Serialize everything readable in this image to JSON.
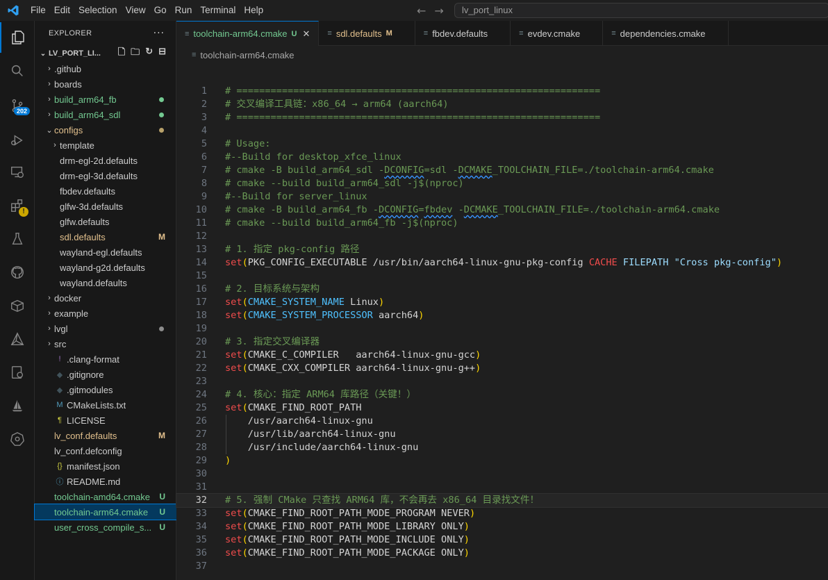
{
  "titlebar": {
    "menu": [
      "File",
      "Edit",
      "Selection",
      "View",
      "Go",
      "Run",
      "Terminal",
      "Help"
    ],
    "search": "lv_port_linux"
  },
  "activity": {
    "scm_badge": "202",
    "warning_badge": "!"
  },
  "explorer": {
    "title": "EXPLORER",
    "more": "···",
    "root": "LV_PORT_LI...",
    "tree": [
      {
        "label": "github",
        "type": "folder",
        "depth": 0,
        "color": "#cccccc"
      },
      {
        "label": "boards",
        "type": "folder",
        "depth": 0,
        "color": "#cccccc"
      },
      {
        "label": "build_arm64_fb",
        "type": "folder",
        "depth": 0,
        "color": "#73c991",
        "dot": "#73c991"
      },
      {
        "label": "build_arm64_sdl",
        "type": "folder",
        "depth": 0,
        "color": "#73c991",
        "dot": "#73c991"
      },
      {
        "label": "configs",
        "type": "folder-open",
        "depth": 0,
        "color": "#e2c08d",
        "dot": "#b8a16a"
      },
      {
        "label": "template",
        "type": "folder",
        "depth": 1,
        "color": "#cccccc"
      },
      {
        "label": "drm-egl-2d.defaults",
        "type": "file",
        "depth": 1,
        "color": "#cccccc"
      },
      {
        "label": "drm-egl-3d.defaults",
        "type": "file",
        "depth": 1,
        "color": "#cccccc"
      },
      {
        "label": "fbdev.defaults",
        "type": "file",
        "depth": 1,
        "color": "#cccccc"
      },
      {
        "label": "glfw-3d.defaults",
        "type": "file",
        "depth": 1,
        "color": "#cccccc"
      },
      {
        "label": "glfw.defaults",
        "type": "file",
        "depth": 1,
        "color": "#cccccc"
      },
      {
        "label": "sdl.defaults",
        "type": "file",
        "depth": 1,
        "color": "#e2c08d",
        "status": "M"
      },
      {
        "label": "wayland-egl.defaults",
        "type": "file",
        "depth": 1,
        "color": "#cccccc"
      },
      {
        "label": "wayland-g2d.defaults",
        "type": "file",
        "depth": 1,
        "color": "#cccccc"
      },
      {
        "label": "wayland.defaults",
        "type": "file",
        "depth": 1,
        "color": "#cccccc"
      },
      {
        "label": "docker",
        "type": "folder",
        "depth": 0,
        "color": "#cccccc"
      },
      {
        "label": "example",
        "type": "folder",
        "depth": 0,
        "color": "#cccccc"
      },
      {
        "label": "lvgl",
        "type": "folder",
        "depth": 0,
        "color": "#cccccc",
        "dot": "#8c8c8c"
      },
      {
        "label": "src",
        "type": "folder",
        "depth": 0,
        "color": "#cccccc"
      },
      {
        "label": ".clang-format",
        "type": "file",
        "depth": 0,
        "color": "#cccccc",
        "icon": "!",
        "iconColor": "#a074c4"
      },
      {
        "label": ".gitignore",
        "type": "file",
        "depth": 0,
        "color": "#cccccc",
        "icon": "◆",
        "iconColor": "#41535b"
      },
      {
        "label": ".gitmodules",
        "type": "file",
        "depth": 0,
        "color": "#cccccc",
        "icon": "◆",
        "iconColor": "#41535b"
      },
      {
        "label": "CMakeLists.txt",
        "type": "file",
        "depth": 0,
        "color": "#cccccc",
        "icon": "M",
        "iconColor": "#519aba"
      },
      {
        "label": "LICENSE",
        "type": "file",
        "depth": 0,
        "color": "#cccccc",
        "icon": "¶",
        "iconColor": "#cbcb41"
      },
      {
        "label": "lv_conf.defaults",
        "type": "file",
        "depth": 0,
        "color": "#e2c08d",
        "status": "M"
      },
      {
        "label": "lv_conf.defconfig",
        "type": "file",
        "depth": 0,
        "color": "#cccccc"
      },
      {
        "label": "manifest.json",
        "type": "file",
        "depth": 0,
        "color": "#cccccc",
        "icon": "{}",
        "iconColor": "#cbcb41"
      },
      {
        "label": "README.md",
        "type": "file",
        "depth": 0,
        "color": "#cccccc",
        "icon": "ⓘ",
        "iconColor": "#519aba"
      },
      {
        "label": "toolchain-amd64.cmake",
        "type": "file",
        "depth": 0,
        "color": "#73c991",
        "status": "U"
      },
      {
        "label": "toolchain-arm64.cmake",
        "type": "file",
        "depth": 0,
        "color": "#73c991",
        "status": "U",
        "selected": true
      },
      {
        "label": "user_cross_compile_s...",
        "type": "file",
        "depth": 0,
        "color": "#73c991",
        "status": "U"
      }
    ]
  },
  "tabs": [
    {
      "label": "toolchain-arm64.cmake",
      "status": "U",
      "statusColor": "#73c991",
      "labelColor": "#73c991",
      "active": true
    },
    {
      "label": "sdl.defaults",
      "status": "M",
      "statusColor": "#e2c08d",
      "labelColor": "#e2c08d"
    },
    {
      "label": "fbdev.defaults",
      "status": "",
      "labelColor": "#cccccc"
    },
    {
      "label": "evdev.cmake",
      "status": "",
      "labelColor": "#cccccc"
    },
    {
      "label": "dependencies.cmake",
      "status": "",
      "labelColor": "#cccccc"
    }
  ],
  "breadcrumb": "toolchain-arm64.cmake",
  "current_line": 32,
  "code": [
    [
      [
        "c",
        "# ================================================================"
      ]
    ],
    [
      [
        "c",
        "# 交叉编译工具链：x86_64 → arm64 (aarch64)"
      ]
    ],
    [
      [
        "c",
        "# ================================================================"
      ]
    ],
    [],
    [
      [
        "c",
        "# Usage:"
      ]
    ],
    [
      [
        "c",
        "#--Build for desktop_xfce_linux"
      ]
    ],
    [
      [
        "c",
        "# cmake -B build_arm64_sdl -"
      ],
      [
        "c sq",
        "DCONFIG"
      ],
      [
        "c",
        "=sdl -"
      ],
      [
        "c sq",
        "DCMAKE"
      ],
      [
        "c",
        "_TOOLCHAIN_FILE=./toolchain-arm64.cmake"
      ]
    ],
    [
      [
        "c",
        "# cmake --build build_arm64_sdl -j$(nproc)"
      ]
    ],
    [
      [
        "c",
        "#--Build for server_linux"
      ]
    ],
    [
      [
        "c",
        "# cmake -B build_arm64_fb -"
      ],
      [
        "c sq",
        "DCONFIG"
      ],
      [
        "c",
        "="
      ],
      [
        "c sq",
        "fbdev"
      ],
      [
        "c",
        " -"
      ],
      [
        "c sq",
        "DCMAKE"
      ],
      [
        "c",
        "_TOOLCHAIN_FILE=./toolchain-arm64.cmake"
      ]
    ],
    [
      [
        "c",
        "# cmake --build build_arm64_fb -j$(nproc)"
      ]
    ],
    [],
    [
      [
        "c",
        "# 1. 指定 pkg-config 路径"
      ]
    ],
    [
      [
        "k",
        "set"
      ],
      [
        "p",
        "("
      ],
      [
        "d",
        "PKG_CONFIG_EXECUTABLE /usr/bin/aarch64-linux-gnu-pkg-config "
      ],
      [
        "k2",
        "CACHE"
      ],
      [
        "d",
        " "
      ],
      [
        "v",
        "FILEPATH"
      ],
      [
        "d",
        " "
      ],
      [
        "s",
        "\"Cross pkg-config\""
      ],
      [
        "p",
        ")"
      ]
    ],
    [],
    [
      [
        "c",
        "# 2. 目标系统与架构"
      ]
    ],
    [
      [
        "k",
        "set"
      ],
      [
        "p",
        "("
      ],
      [
        "ov",
        "CMAKE_SYSTEM_NAME"
      ],
      [
        "d",
        " Linux"
      ],
      [
        "p",
        ")"
      ]
    ],
    [
      [
        "k",
        "set"
      ],
      [
        "p",
        "("
      ],
      [
        "ov",
        "CMAKE_SYSTEM_PROCESSOR"
      ],
      [
        "d",
        " aarch64"
      ],
      [
        "p",
        ")"
      ]
    ],
    [],
    [
      [
        "c",
        "# 3. 指定交叉编译器"
      ]
    ],
    [
      [
        "k",
        "set"
      ],
      [
        "p",
        "("
      ],
      [
        "d",
        "CMAKE_C_COMPILER   aarch64-linux-gnu-gcc"
      ],
      [
        "p",
        ")"
      ]
    ],
    [
      [
        "k",
        "set"
      ],
      [
        "p",
        "("
      ],
      [
        "d",
        "CMAKE_CXX_COMPILER aarch64-linux-gnu-g++"
      ],
      [
        "p",
        ")"
      ]
    ],
    [],
    [
      [
        "c",
        "# 4. 核心：指定 ARM64 库路径（关键！）"
      ]
    ],
    [
      [
        "k",
        "set"
      ],
      [
        "p",
        "("
      ],
      [
        "d",
        "CMAKE_FIND_ROOT_PATH"
      ]
    ],
    [
      [
        "d",
        "    /usr/aarch64-linux-gnu"
      ]
    ],
    [
      [
        "d",
        "    /usr/lib/aarch64-linux-gnu"
      ]
    ],
    [
      [
        "d",
        "    /usr/include/aarch64-linux-gnu"
      ]
    ],
    [
      [
        "p",
        ")"
      ]
    ],
    [],
    [],
    [
      [
        "c",
        "# 5. 强制 CMake 只查找 ARM64 库，不会再去 x86_64 目录找文件！"
      ]
    ],
    [
      [
        "k",
        "set"
      ],
      [
        "p",
        "("
      ],
      [
        "d",
        "CMAKE_FIND_ROOT_PATH_MODE_PROGRAM NEVER"
      ],
      [
        "p",
        ")"
      ]
    ],
    [
      [
        "k",
        "set"
      ],
      [
        "p",
        "("
      ],
      [
        "d",
        "CMAKE_FIND_ROOT_PATH_MODE_LIBRARY ONLY"
      ],
      [
        "p",
        ")"
      ]
    ],
    [
      [
        "k",
        "set"
      ],
      [
        "p",
        "("
      ],
      [
        "d",
        "CMAKE_FIND_ROOT_PATH_MODE_INCLUDE ONLY"
      ],
      [
        "p",
        ")"
      ]
    ],
    [
      [
        "k",
        "set"
      ],
      [
        "p",
        "("
      ],
      [
        "d",
        "CMAKE_FIND_ROOT_PATH_MODE_PACKAGE ONLY"
      ],
      [
        "p",
        ")"
      ]
    ],
    []
  ]
}
